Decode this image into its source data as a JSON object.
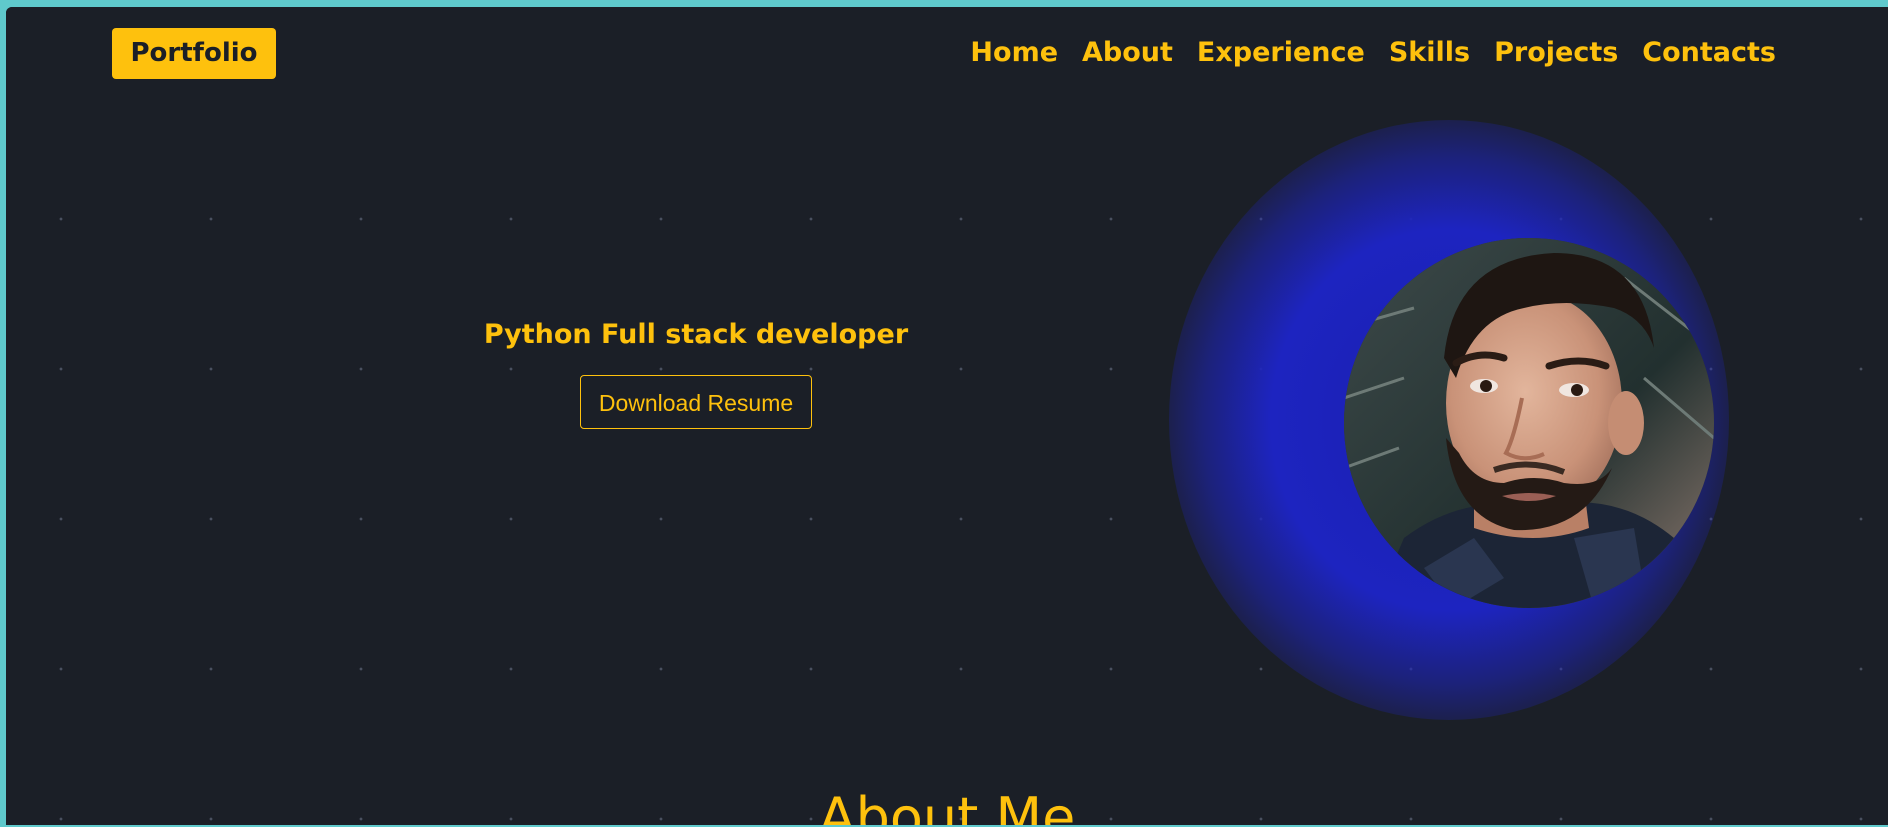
{
  "navbar": {
    "brand": "Portfolio",
    "links": [
      "Home",
      "About",
      "Experience",
      "Skills",
      "Projects",
      "Contacts"
    ]
  },
  "hero": {
    "title": "Python Full stack developer",
    "resume_button": "Download Resume",
    "avatar_icon": "profile-photo"
  },
  "about": {
    "heading": "About Me"
  },
  "colors": {
    "accent": "#fec10d",
    "background": "#1b1f27",
    "glow": "#1d24c0",
    "frame": "#5fc9cc"
  }
}
